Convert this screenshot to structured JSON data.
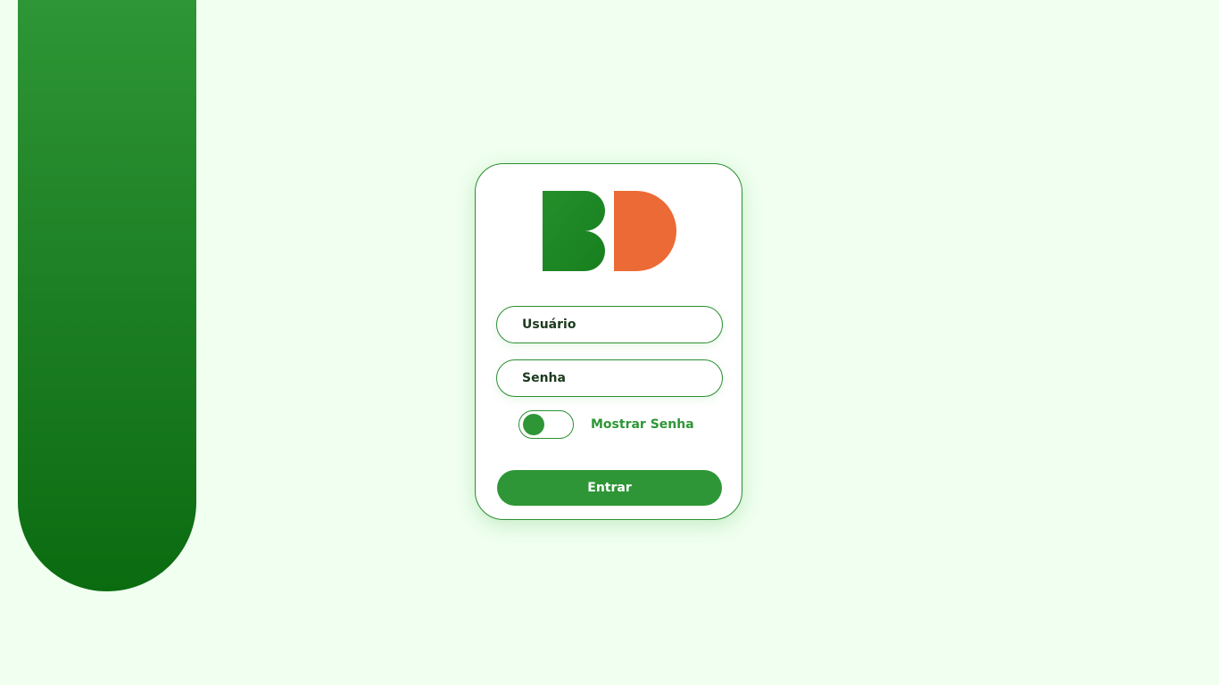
{
  "form": {
    "username_placeholder": "Usuário",
    "username_value": "",
    "password_placeholder": "Senha",
    "password_value": "",
    "show_password_label": "Mostrar Senha",
    "show_password_on": false,
    "submit_label": "Entrar"
  },
  "logo": {
    "name": "bd-logo-icon",
    "colors": {
      "left_letter": "#1e8a26",
      "right_letter": "#ec6a35"
    }
  },
  "theme": {
    "background": "#f0fff0",
    "primary": "#2e9636",
    "primary_dark": "#0b6b10",
    "accent": "#ec6a35",
    "text": "#1d3a1f"
  }
}
